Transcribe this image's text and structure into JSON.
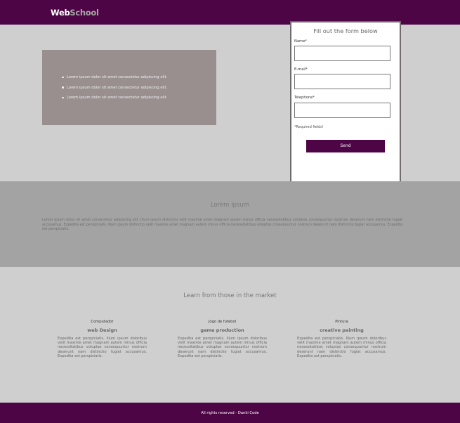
{
  "header": {
    "logo_part1": "Web",
    "logo_part2": "School"
  },
  "hero": {
    "bullets": [
      "Lorem ipsum dolor sit amet consectetur adipiscing elit.",
      "Lorem ipsum dolor sit amet consectetur adipiscing elit.",
      "Lorem ipsum dolor sit amet consectetur adipiscing elit."
    ]
  },
  "form": {
    "title": "Fill out the form below",
    "name_label": "Name*",
    "email_label": "E-mail*",
    "phone_label": "Telephone*",
    "name_value": "",
    "email_value": "",
    "phone_value": "",
    "required_note": "*Required fields!",
    "send_label": "Send"
  },
  "about": {
    "title": "Lorem Ipsum",
    "text": "Lorem ipsum dolor sit amet consectetur adipiscing elit. Illum ipsum distinctio velit maxime amet magnam autem minus officia necessitatibus voluptas consequuntur nostrum deserunt nam distinctio fugiat accusamus. Expedita est perspiciatis. Illum ipsum distinctio velit maxime amet magnam autem minus officia necessitatibus voluptas consequuntur nostrum deserunt nam distinctio fugiat accusamus. Expedita est perspiciatis."
  },
  "learn": {
    "title": "Learn from those in the market",
    "columns": [
      {
        "category": "Computador",
        "heading": "web Design",
        "text": "Expedita est perspiciatis. Illum ipsum doloribus velit maxime amet magnam autem minus officia necessitatibus voluptas consequuntur nostrum deserunt nam distinctio fugiat accusamus. Expedita est perspiciatis."
      },
      {
        "category": "Jogo de futebol",
        "heading": "game production",
        "text": "Expedita est perspiciatis. Illum ipsum doloribus velit maxime amet magnam autem minus officia necessitatibus voluptas consequuntur nostrum deserunt nam distinctio fugiat accusamus. Expedita est perspiciatis."
      },
      {
        "category": "Pintura",
        "heading": "creative painting",
        "text": "Expedita est perspiciatis. Illum ipsum doloribus velit maxime amet magnam autem minus officia necessitatibus voluptas consequuntur nostrum deserunt nam distinctio fugiat accusamus. Expedita est perspiciatis."
      }
    ]
  },
  "footer": {
    "text": "All rights reserved - Danki Code"
  },
  "colors": {
    "brand": "#4e0545",
    "page_bg": "#cfcfcf",
    "band_bg": "#a3a3a3",
    "info_box": "#998f8f"
  }
}
